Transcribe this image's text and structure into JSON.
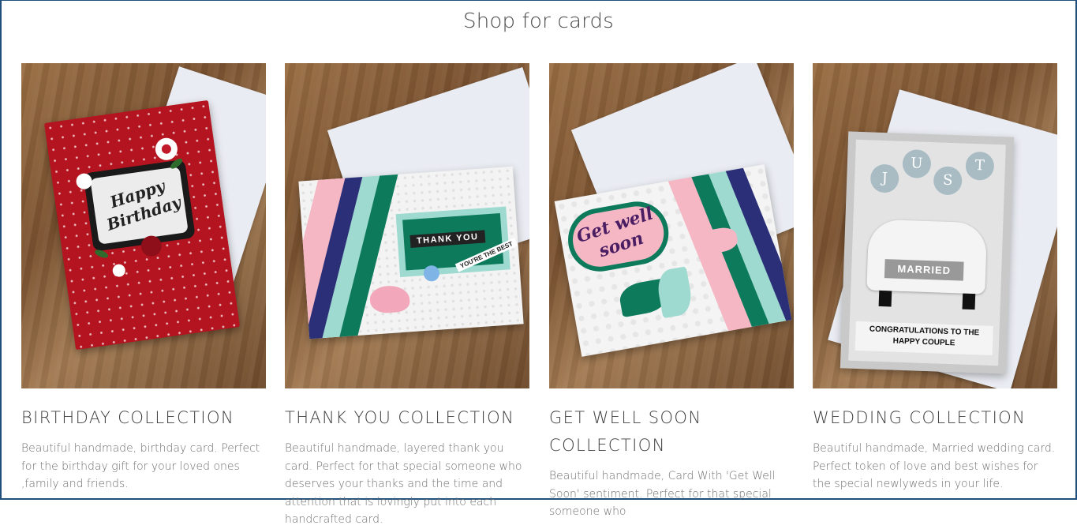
{
  "section_title": "Shop for cards",
  "cards": [
    {
      "title": "BIRTHDAY COLLECTION",
      "description": "Beautiful handmade, birthday card. Perfect for the birthday gift for your loved ones ,family and friends.",
      "image": {
        "card_text": "Happy Birthday",
        "card_color": "#b4141f"
      }
    },
    {
      "title": "THANK YOU COLLECTION",
      "description": "Beautiful handmade, layered thank you card. Perfect for that special someone who deserves your thanks and the time and attention that is lovingly put into each handcrafted card.",
      "image": {
        "card_text": "THANK YOU",
        "banner_text": "YOU'RE THE BEST",
        "card_color": "#f2f2f2"
      }
    },
    {
      "title": "GET WELL SOON COLLECTION",
      "description": "Beautiful handmade, Card With 'Get Well Soon' sentiment. Perfect for that special someone who",
      "image": {
        "card_text": "Get well soon",
        "card_color": "#f2f2f2"
      }
    },
    {
      "title": "WEDDING COLLECTION",
      "description": "Beautiful handmade, Married wedding card. Perfect token of love and best wishes for the special newlyweds in your life.",
      "image": {
        "balloon_letters": [
          "J",
          "U",
          "S",
          "T"
        ],
        "plate_text": "MARRIED",
        "caption_text": "CONGRATULATIONS TO THE HAPPY COUPLE",
        "card_color": "#c9c9c9"
      }
    }
  ]
}
